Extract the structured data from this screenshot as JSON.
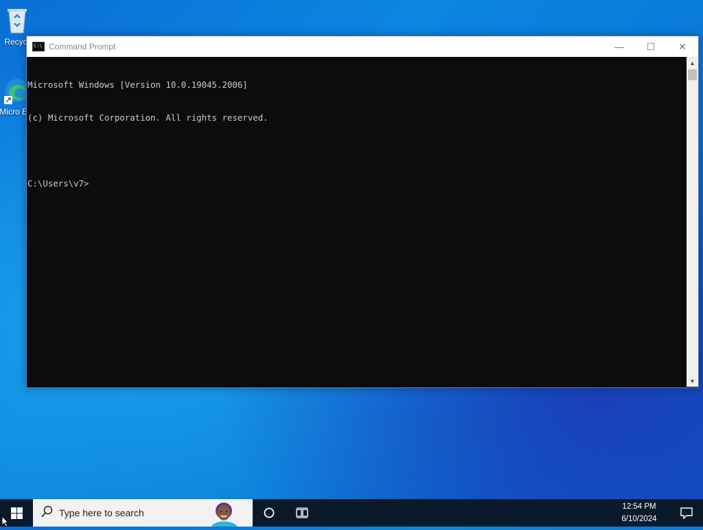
{
  "desktop": {
    "icons": [
      {
        "label": "Recyc",
        "icon": "recycle-bin-icon"
      },
      {
        "label": "Micro Ed",
        "icon": "edge-icon"
      }
    ]
  },
  "window": {
    "title": "Command Prompt",
    "icon": "cmd-icon",
    "controls": {
      "minimize": "—",
      "maximize": "☐",
      "close": "✕"
    }
  },
  "console": {
    "lines": [
      "Microsoft Windows [Version 10.0.19045.2006]",
      "(c) Microsoft Corporation. All rights reserved.",
      "",
      "C:\\Users\\v7>"
    ]
  },
  "taskbar": {
    "search_placeholder": "Type here to search",
    "time": "12:54 PM",
    "date": "6/10/2024",
    "icons": [
      "windows-start-icon",
      "search-icon",
      "cortana-icon",
      "task-view-icon",
      "notification-icon"
    ]
  },
  "colors": {
    "console_bg": "#0c0c0c",
    "console_text": "#cccccc",
    "taskbar_bg": "#0b1a2a"
  }
}
